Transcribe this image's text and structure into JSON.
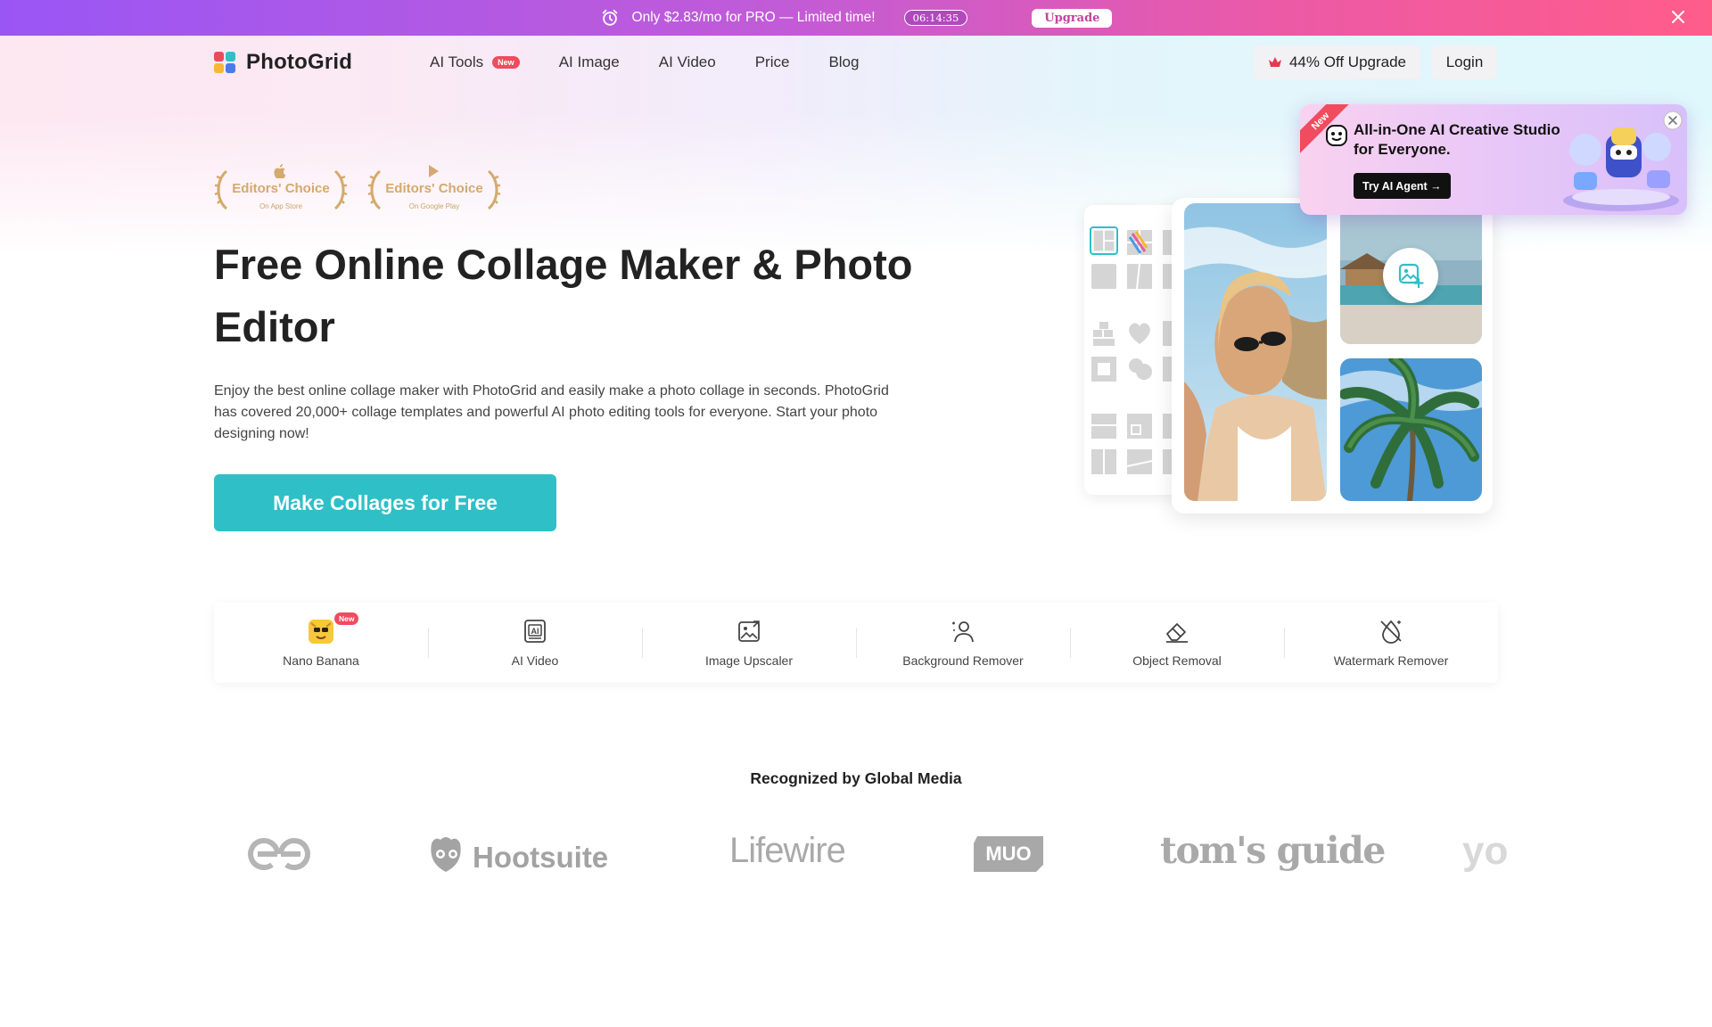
{
  "promo": {
    "text": "Only $2.83/mo for PRO — Limited time!",
    "timer": "06:14:35",
    "upgrade_label": "Upgrade"
  },
  "header": {
    "brand": "PhotoGrid",
    "nav": [
      {
        "label": "AI Tools",
        "badge": "New"
      },
      {
        "label": "AI Image"
      },
      {
        "label": "AI Video"
      },
      {
        "label": "Price"
      },
      {
        "label": "Blog"
      }
    ],
    "upgrade_label": "44% Off Upgrade",
    "login_label": "Login"
  },
  "badges": [
    {
      "title": "Editors' Choice",
      "store": "On App Store",
      "icon": "apple-icon"
    },
    {
      "title": "Editors' Choice",
      "store": "On Google Play",
      "icon": "google-play-icon"
    }
  ],
  "hero": {
    "title": "Free Online Collage Maker & Photo Editor",
    "description": "Enjoy the best online collage maker with PhotoGrid and easily make a photo collage in seconds. PhotoGrid has covered 20,000+ collage templates and powerful AI photo editing tools for everyone. Start your photo designing now!",
    "cta_label": "Make Collages for Free"
  },
  "agent_popup": {
    "ribbon": "New",
    "title": "All-in-One AI Creative Studio for Everyone.",
    "button_label": "Try AI Agent →"
  },
  "tools": [
    {
      "label": "Nano Banana",
      "badge": "New",
      "icon": "nano-banana-icon"
    },
    {
      "label": "AI Video",
      "icon": "ai-video-icon"
    },
    {
      "label": "Image Upscaler",
      "icon": "image-upscaler-icon"
    },
    {
      "label": "Background Remover",
      "icon": "background-remover-icon"
    },
    {
      "label": "Object Removal",
      "icon": "eraser-icon"
    },
    {
      "label": "Watermark Remover",
      "icon": "watermark-remover-icon"
    }
  ],
  "media": {
    "title": "Recognized by Global Media",
    "logos": [
      "GG",
      "Hootsuite",
      "Lifewire",
      "MUO",
      "tom's guide",
      "yo"
    ]
  },
  "colors": {
    "accent": "#2fbfc7",
    "promo_start": "#9a56f5",
    "promo_end": "#ff5c8a",
    "badge_red": "#f04b5e",
    "gold": "#d4aa6d"
  }
}
